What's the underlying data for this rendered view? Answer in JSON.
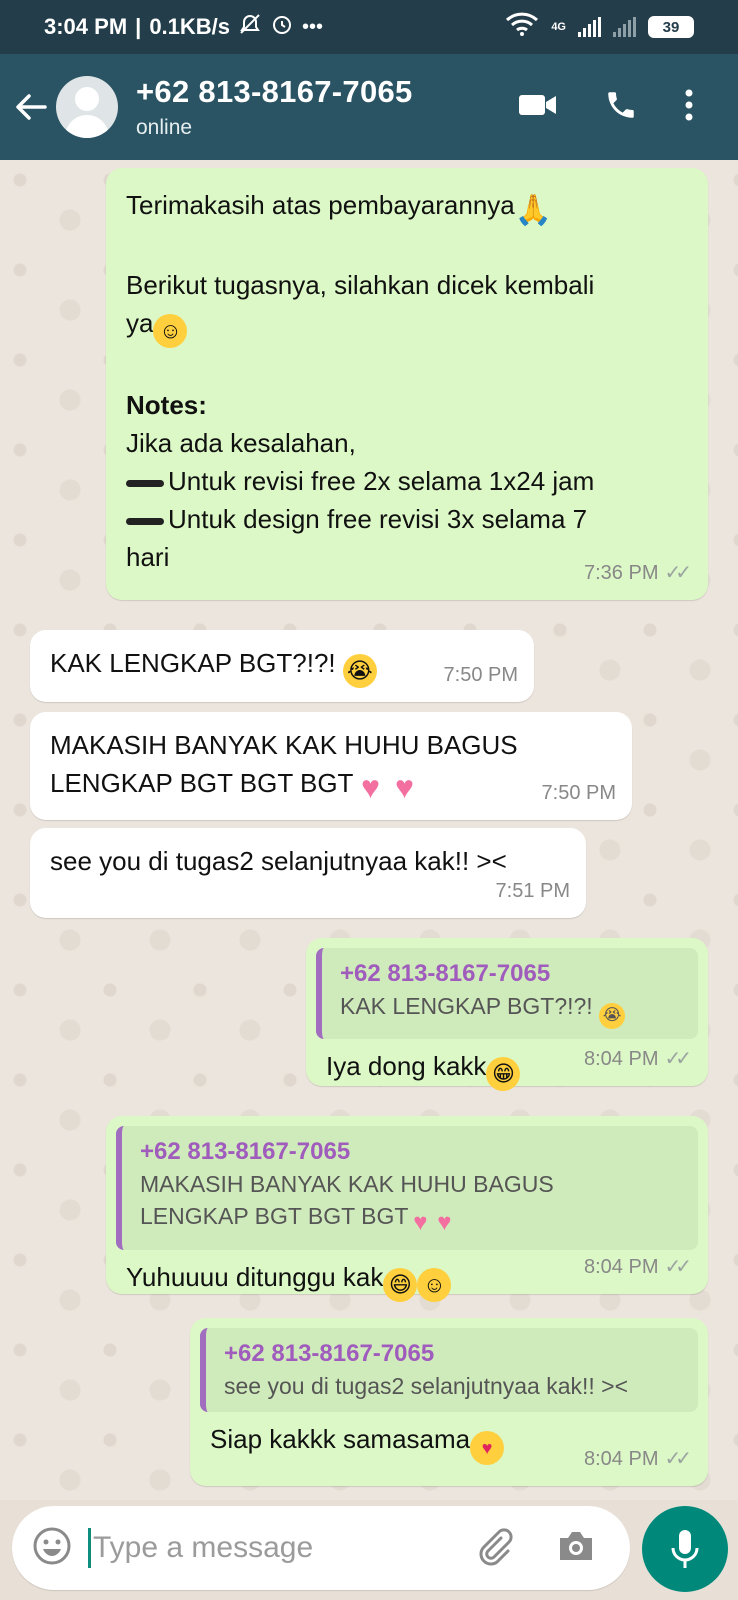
{
  "status_bar": {
    "time": "3:04 PM",
    "network_speed": "0.1KB/s",
    "network_type": "4G",
    "battery": "39"
  },
  "header": {
    "contact_name": "+62 813-8167-7065",
    "contact_status": "online"
  },
  "messages": [
    {
      "direction": "out",
      "lines": [
        "Terimakasih atas pembayarannya",
        "Berikut tugasnya, silahkan dicek kembali",
        "ya",
        "Notes:",
        "Jika ada kesalahan,",
        "Untuk revisi free 2x selama 1x24 jam",
        "Untuk design free revisi 3x selama 7",
        "hari"
      ],
      "time": "7:36 PM"
    },
    {
      "direction": "in",
      "text": "KAK LENGKAP BGT?!?!",
      "time": "7:50 PM"
    },
    {
      "direction": "in",
      "lines": [
        "MAKASIH BANYAK KAK HUHU BAGUS",
        "LENGKAP BGT BGT BGT"
      ],
      "time": "7:50 PM"
    },
    {
      "direction": "in",
      "text": "see you di tugas2 selanjutnyaa kak!! ><",
      "time": "7:51 PM"
    },
    {
      "direction": "out",
      "quote_name": "+62 813-8167-7065",
      "quote_text": "KAK LENGKAP BGT?!?!",
      "text": "Iya dong kakk",
      "time": "8:04 PM"
    },
    {
      "direction": "out",
      "quote_name": "+62 813-8167-7065",
      "quote_lines": [
        "MAKASIH BANYAK KAK HUHU BAGUS",
        "LENGKAP BGT BGT BGT"
      ],
      "text": "Yuhuuuu ditunggu kak",
      "time": "8:04 PM"
    },
    {
      "direction": "out",
      "quote_name": "+62 813-8167-7065",
      "quote_text": "see you di tugas2 selanjutnyaa kak!! ><",
      "text": "Siap kakkk samasama",
      "time": "8:04 PM"
    }
  ],
  "composer": {
    "placeholder": "Type a message"
  },
  "colors": {
    "header_bg": "#2a5463",
    "outgoing_bubble": "#dcf8c6",
    "incoming_bubble": "#ffffff",
    "quote_accent": "#9f5cbd",
    "mic_button": "#00897b"
  }
}
